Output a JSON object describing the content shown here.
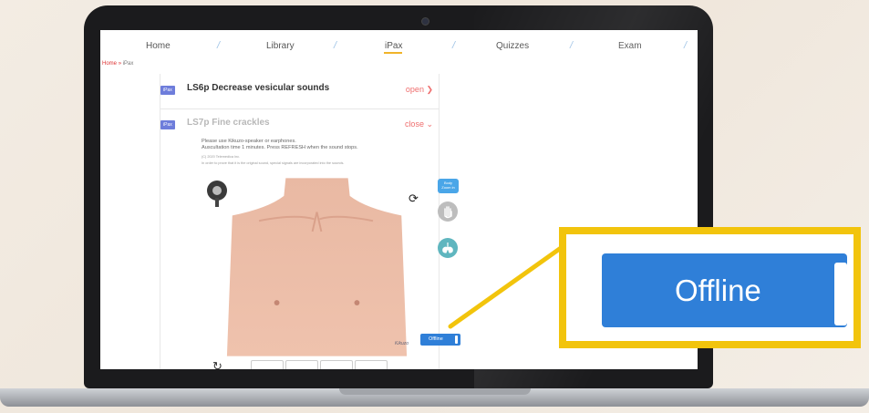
{
  "nav": {
    "items": [
      "Home",
      "Library",
      "iPax",
      "Quizzes",
      "Exam"
    ],
    "separator": "/",
    "active": "iPax"
  },
  "breadcrumb": {
    "home": "Home",
    "sep": "»",
    "current": "iPax"
  },
  "sounds": [
    {
      "tag": "iPax",
      "title": "LS6p Decrease vesicular sounds",
      "action": "open ❯",
      "expanded": false
    },
    {
      "tag": "iPax",
      "title": "LS7p Fine crackles",
      "action": "close ⌄",
      "expanded": true
    }
  ],
  "player": {
    "instructions_line1": "Please use Kikuzo-speaker or earphones.",
    "instructions_line2": "Auscultation time 1 minutes. Press REFRESH when the sound stops.",
    "copyright": "(C) 2020 Telemedica Inc.",
    "note": "In order to prove that it is the original sound, special signals are incorporated into the sounds.",
    "zoom_line1": "Body",
    "zoom_line2": "Zoom in",
    "offline_label": "Offline",
    "signature": "Kikuzo"
  },
  "callout": {
    "label": "Offline"
  },
  "colors": {
    "accent": "#2f7fd8",
    "tag": "#6e7ddb",
    "highlight": "#f2c40c",
    "action": "#ef6f6f",
    "underline": "#f0b429"
  },
  "icons": [
    "stethoscope-icon",
    "refresh-icon",
    "hand-icon",
    "lungs-icon",
    "reload-icon"
  ]
}
